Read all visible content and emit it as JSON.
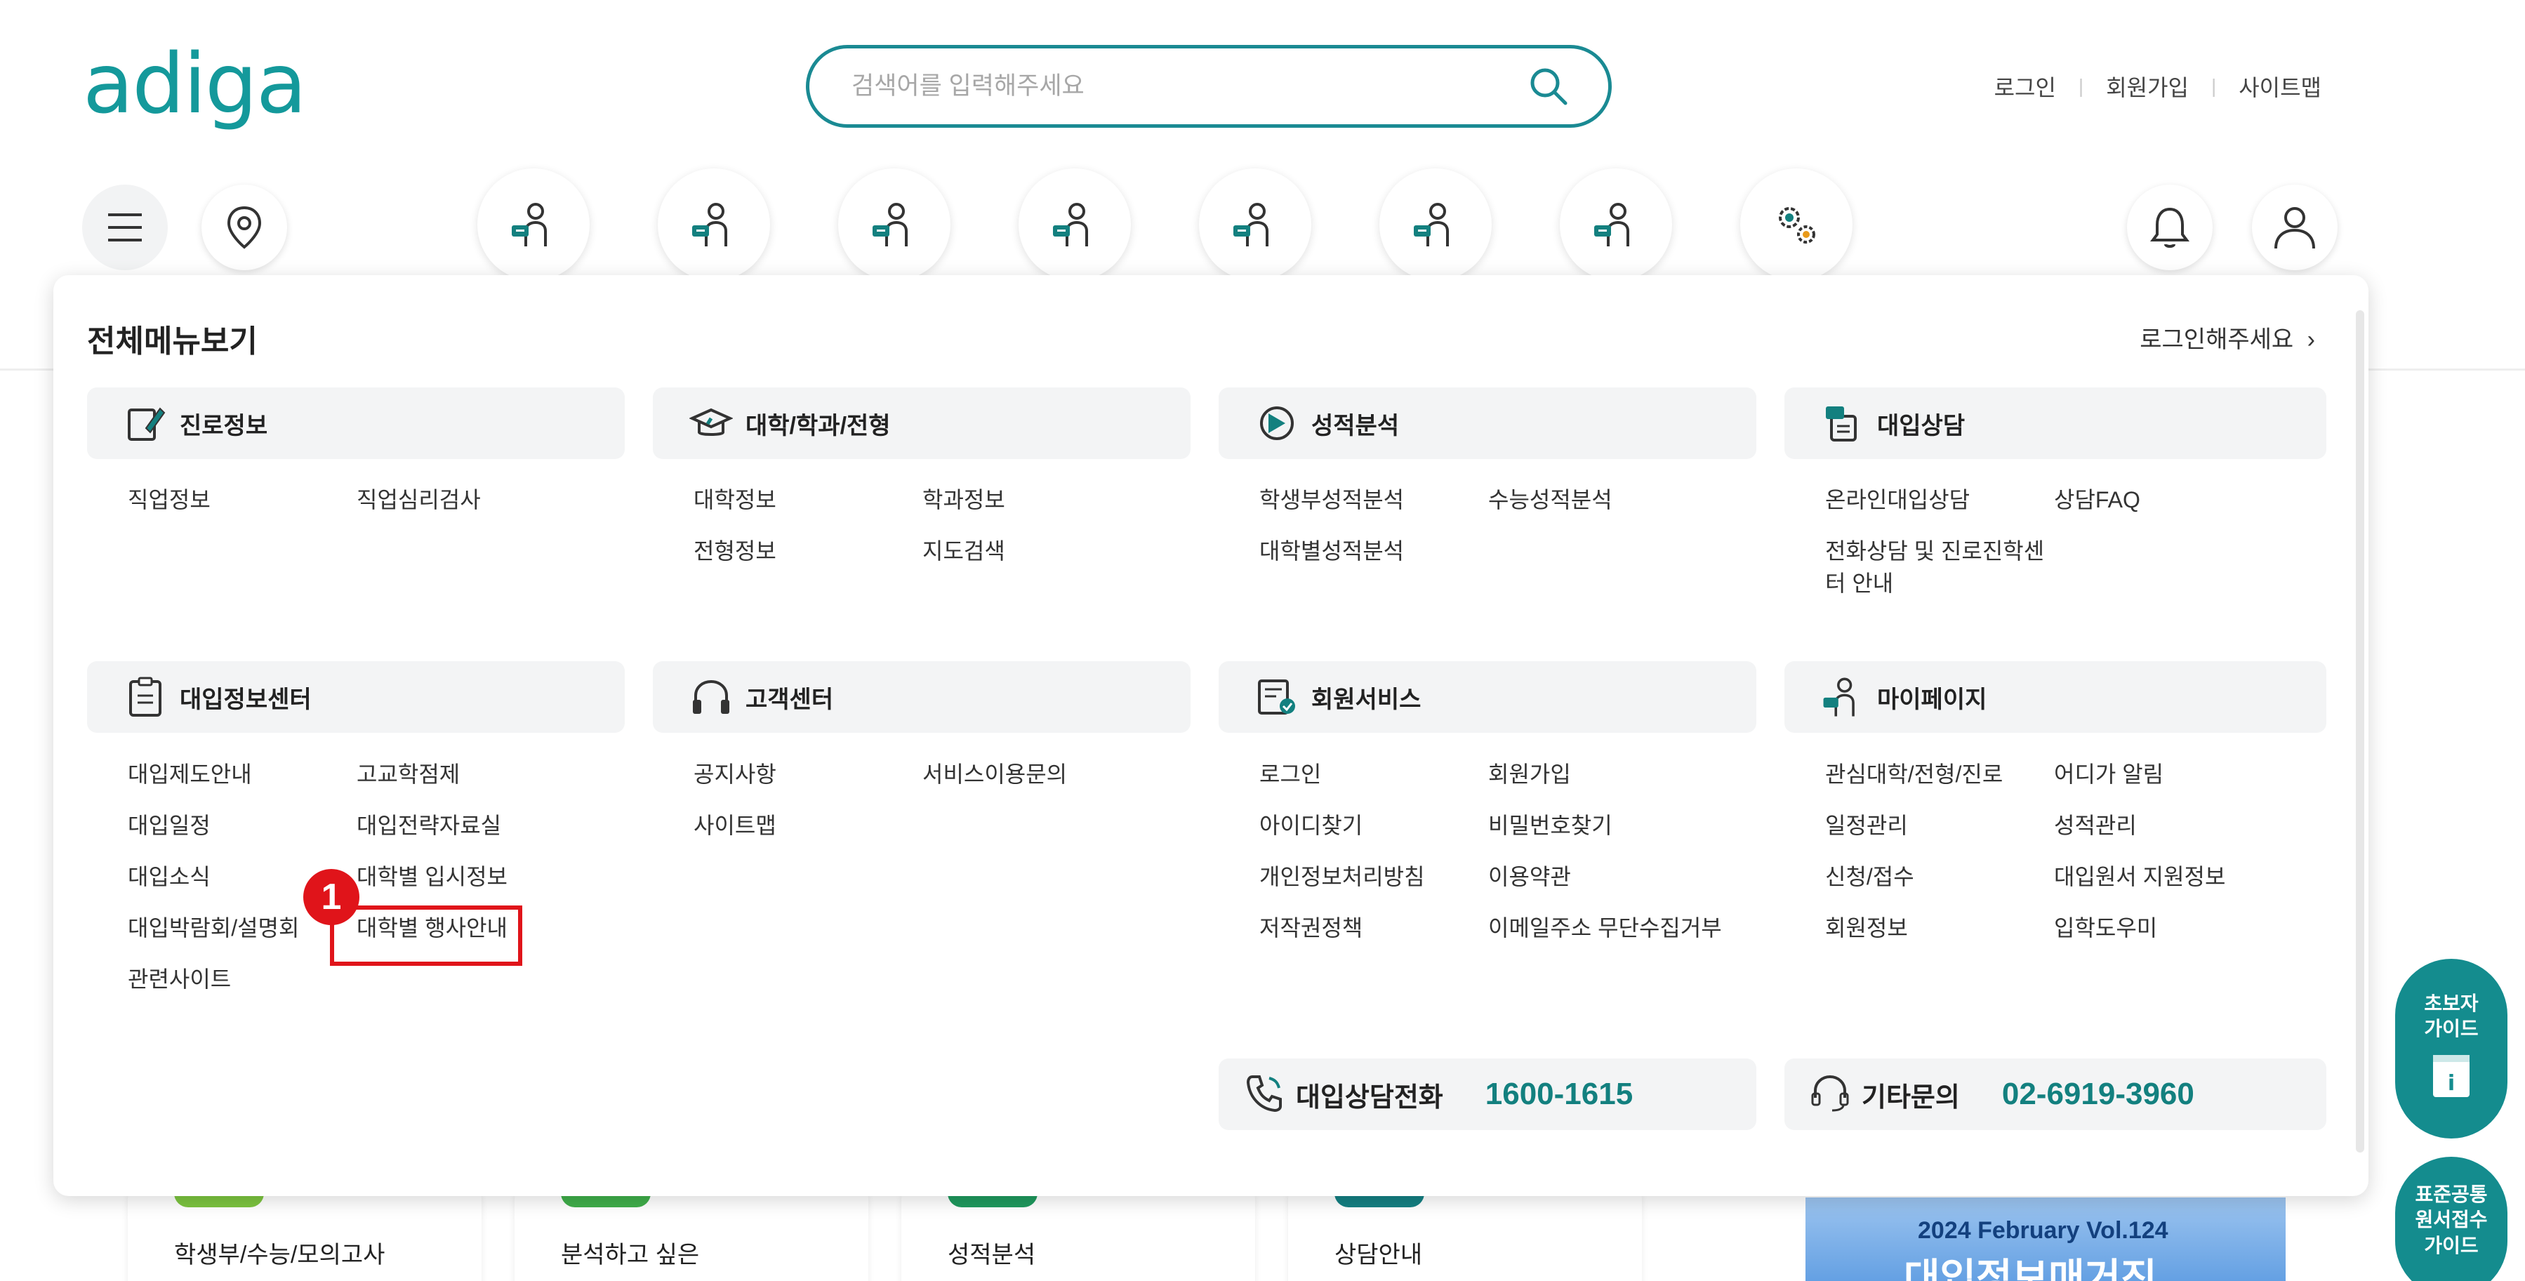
{
  "header": {
    "logo": "adiga",
    "search_placeholder": "검색어를 입력해주세요",
    "top_links": [
      "로그인",
      "회원가입",
      "사이트맵"
    ]
  },
  "panel": {
    "title": "전체메뉴보기",
    "login_prompt": "로그인해주세요",
    "sections": [
      {
        "label": "진로정보",
        "icon": "pencil-doc-icon",
        "items": [
          "직업정보",
          "직업심리검사"
        ]
      },
      {
        "label": "대학/학과/전형",
        "icon": "graduation-cap-icon",
        "items": [
          "대학정보",
          "학과정보",
          "전형정보",
          "지도검색"
        ]
      },
      {
        "label": "성적분석",
        "icon": "chart-analysis-icon",
        "items": [
          "학생부성적분석",
          "수능성적분석",
          "대학별성적분석"
        ]
      },
      {
        "label": "대입상담",
        "icon": "consult-icon",
        "items": [
          "온라인대입상담",
          "상담FAQ",
          "전화상담 및 진로진학센터 안내"
        ]
      },
      {
        "label": "대입정보센터",
        "icon": "clipboard-icon",
        "items": [
          "대입제도안내",
          "고교학점제",
          "대입일정",
          "대입전략자료실",
          "대입소식",
          "대학별 입시정보",
          "대입박람회/설명회",
          "대학별 행사안내",
          "관련사이트"
        ]
      },
      {
        "label": "고객센터",
        "icon": "headphones-icon",
        "items": [
          "공지사항",
          "서비스이용문의",
          "사이트맵"
        ]
      },
      {
        "label": "회원서비스",
        "icon": "member-card-icon",
        "items": [
          "로그인",
          "회원가입",
          "아이디찾기",
          "비밀번호찾기",
          "개인정보처리방침",
          "이용약관",
          "저작권정책",
          "이메일주소 무단수집거부"
        ]
      },
      {
        "label": "마이페이지",
        "icon": "user-icon",
        "items": [
          "관심대학/전형/진로",
          "어디가 알림",
          "일정관리",
          "성적관리",
          "신청/접수",
          "대입원서 지원정보",
          "회원정보",
          "입학도우미"
        ]
      }
    ],
    "contacts": [
      {
        "label": "대입상담전화",
        "number": "1600-1615",
        "icon": "phone-icon"
      },
      {
        "label": "기타문의",
        "number": "02-6919-3960",
        "icon": "headset-icon"
      }
    ],
    "annotation_badge": "1"
  },
  "below": {
    "cards": [
      "학생부/수능/모의고사",
      "분석하고 싶은",
      "성적분석",
      "상담안내"
    ],
    "banner_line1": "2024 February Vol.124",
    "banner_line2": "대입정보매거진"
  },
  "side_buttons": [
    {
      "label_line1": "초보자",
      "label_line2": "가이드"
    },
    {
      "label_line1": "표준공통",
      "label_line2": "원서접수",
      "label_line3": "가이드"
    }
  ],
  "colors": {
    "brand": "#14999b",
    "highlight": "#e0141a",
    "accent_number": "#13807f"
  }
}
